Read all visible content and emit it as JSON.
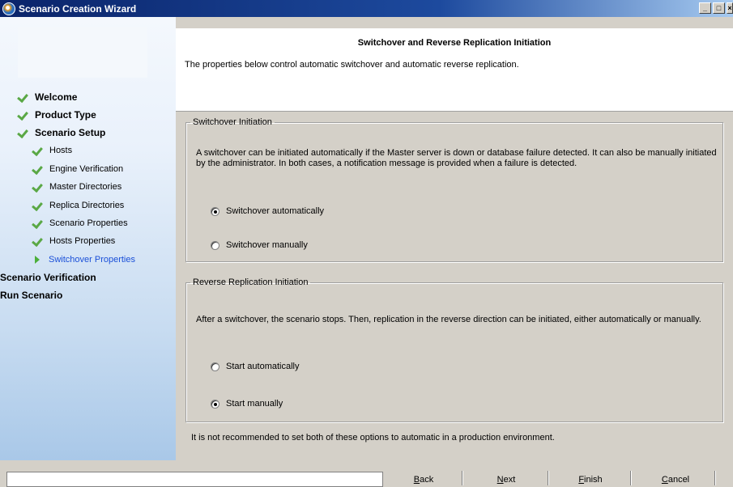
{
  "window": {
    "title": "Scenario Creation Wizard"
  },
  "sidebar": {
    "steps": [
      {
        "label": "Welcome",
        "state": "done"
      },
      {
        "label": "Product Type",
        "state": "done"
      },
      {
        "label": "Scenario Setup",
        "state": "done"
      },
      {
        "label": "Hosts",
        "state": "done"
      },
      {
        "label": "Engine Verification",
        "state": "done"
      },
      {
        "label": "Master Directories",
        "state": "done"
      },
      {
        "label": "Replica Directories",
        "state": "done"
      },
      {
        "label": "Scenario Properties",
        "state": "done"
      },
      {
        "label": "Hosts Properties",
        "state": "done"
      },
      {
        "label": "Switchover Properties",
        "state": "current"
      },
      {
        "label": "Scenario Verification",
        "state": "pending"
      },
      {
        "label": "Run Scenario",
        "state": "pending"
      }
    ]
  },
  "header": {
    "title": "Switchover and Reverse Replication Initiation",
    "subtitle": "The properties below control automatic switchover and automatic reverse replication."
  },
  "switchover": {
    "legend": "Switchover Initiation",
    "description": "A switchover can be initiated automatically if the Master server is down or database failure detected. It can also be manually initiated by the administrator. In both cases, a notification message is provided when a failure is detected.",
    "options": [
      {
        "label": "Switchover automatically",
        "selected": true
      },
      {
        "label": "Switchover manually",
        "selected": false
      }
    ]
  },
  "reverse": {
    "legend": "Reverse Replication Initiation",
    "description": "After a switchover, the scenario stops. Then, replication in the reverse direction can be initiated, either automatically or manually.",
    "options": [
      {
        "label": "Start automatically",
        "selected": false
      },
      {
        "label": "Start manually",
        "selected": true
      }
    ]
  },
  "note": "It is not recommended to set both of these options to automatic in a production environment.",
  "buttons": {
    "back": {
      "first": "B",
      "rest": "ack"
    },
    "next": {
      "first": "N",
      "rest": "ext"
    },
    "finish": {
      "first": "F",
      "rest": "inish"
    },
    "cancel": {
      "first": "C",
      "rest": "ancel"
    }
  },
  "colors": {
    "title_bar": "#0a246a",
    "current_step": "#1a4fd8",
    "check": "#5aa845"
  }
}
